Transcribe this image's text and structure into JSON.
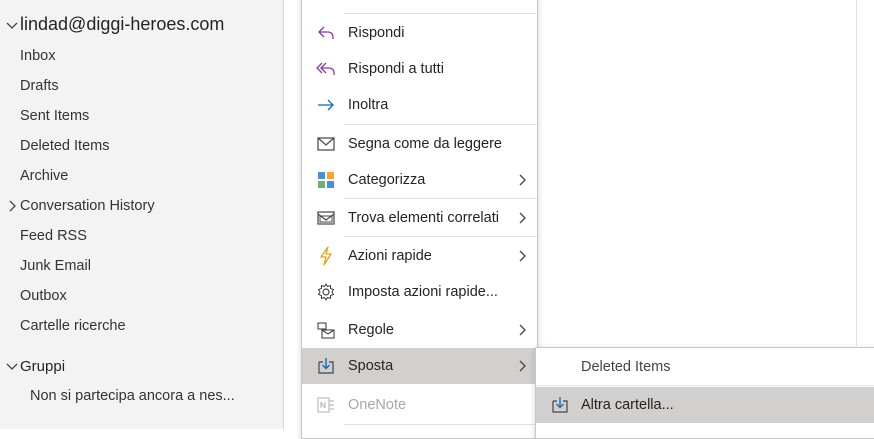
{
  "folder_pane": {
    "account": "lindad@diggi-heroes.com",
    "folders": [
      {
        "label": "Inbox"
      },
      {
        "label": "Drafts"
      },
      {
        "label": "Sent Items"
      },
      {
        "label": "Deleted Items"
      },
      {
        "label": "Archive"
      },
      {
        "label": "Conversation History",
        "has_chevron": true
      },
      {
        "label": "Feed RSS"
      },
      {
        "label": "Junk Email"
      },
      {
        "label": "Outbox"
      },
      {
        "label": "Cartelle ricerche"
      }
    ],
    "group_header": "Gruppi",
    "group_sub": "Non si partecipa ancora a nes..."
  },
  "context_menu": {
    "items": [
      {
        "label": "Rispondi",
        "accel_pre": "",
        "accel": "R",
        "accel_post": "ispondi",
        "icon": "reply-icon"
      },
      {
        "label": "Rispondi a tutti",
        "icon": "reply-all-icon"
      },
      {
        "label": "Inoltra",
        "icon": "forward-icon"
      },
      {
        "label": "Segna come da leggere",
        "icon": "mark-unread-icon"
      },
      {
        "label": "Categorizza",
        "icon": "categorize-icon",
        "submenu": true
      },
      {
        "label": "Trova elementi correlati",
        "icon": "find-related-icon",
        "submenu": true
      },
      {
        "label": "Azioni rapide",
        "icon": "quick-steps-icon",
        "submenu": true
      },
      {
        "label": "Imposta azioni rapide...",
        "icon": "settings-icon"
      },
      {
        "label": "Regole",
        "icon": "rules-icon",
        "submenu": true
      },
      {
        "label": "Sposta",
        "icon": "move-icon",
        "submenu": true,
        "active": true
      },
      {
        "label": "OneNote",
        "icon": "onenote-icon",
        "disabled": true
      }
    ]
  },
  "sub_menu": {
    "items": [
      {
        "label": "Deleted Items"
      },
      {
        "label": "Altra cartella...",
        "icon": "move-to-folder-icon",
        "active": true
      }
    ]
  },
  "colors": {
    "accent": "#0f6cbd",
    "purple": "#8a3ba0",
    "active_bg": "#d2d0ce"
  }
}
